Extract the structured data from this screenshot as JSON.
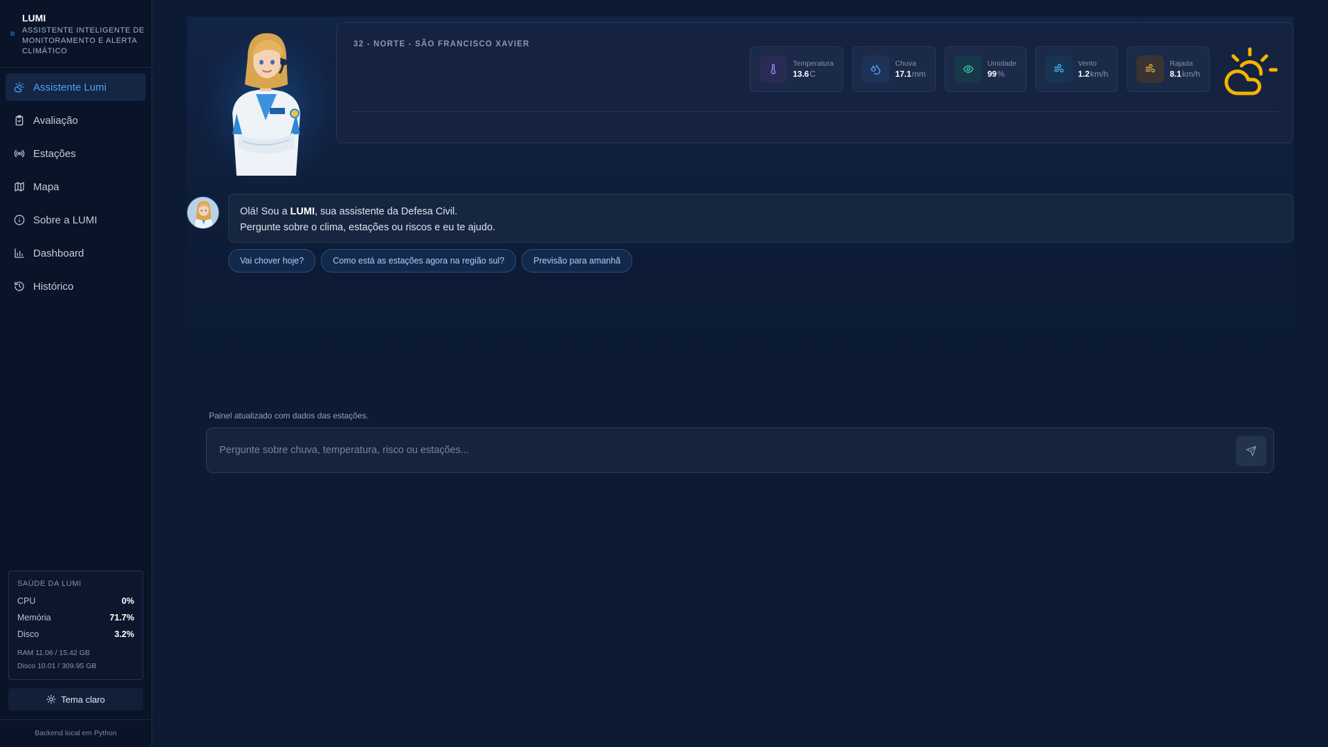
{
  "brand": {
    "title": "LUMI",
    "subtitle": "Assistente inteligente de monitoramento e alerta climático"
  },
  "nav": {
    "items": [
      {
        "label": "Assistente Lumi",
        "icon": "weather-icon",
        "active": true
      },
      {
        "label": "Avaliação",
        "icon": "clipboard-icon"
      },
      {
        "label": "Estações",
        "icon": "radio-icon"
      },
      {
        "label": "Mapa",
        "icon": "map-icon"
      },
      {
        "label": "Sobre a LUMI",
        "icon": "info-icon"
      },
      {
        "label": "Dashboard",
        "icon": "bar-chart-icon"
      },
      {
        "label": "Histórico",
        "icon": "history-icon"
      }
    ]
  },
  "health": {
    "title": "SAÚDE DA LUMI",
    "cpu_label": "CPU",
    "cpu_value": "0%",
    "mem_label": "Memória",
    "mem_value": "71.7%",
    "disk_label": "Disco",
    "disk_value": "3.2%",
    "ram_detail": "RAM 11.06 / 15.42 GB",
    "disk_detail": "Disco 10.01 / 309.95 GB"
  },
  "theme_button": {
    "label": "Tema claro",
    "icon": "sun-icon"
  },
  "footer": {
    "text": "Backend local em Python"
  },
  "weather": {
    "station": "32 - NORTE - SÃO FRANCISCO XAVIER",
    "big_icon": "partly-sunny-icon",
    "accent": "#f5b400",
    "metrics": [
      {
        "label": "Temperatura",
        "value": "13.6",
        "unit": "C",
        "icon": "thermometer-icon",
        "color": "#a98bff",
        "bg": "#2a2b55"
      },
      {
        "label": "Chuva",
        "value": "17.1",
        "unit": "mm",
        "icon": "droplets-icon",
        "color": "#5aa7ff",
        "bg": "#1f3358"
      },
      {
        "label": "Umidade",
        "value": "99",
        "unit": "%",
        "icon": "eye-icon",
        "color": "#3fd3a6",
        "bg": "#17384a"
      },
      {
        "label": "Vento",
        "value": "1.2",
        "unit": "km/h",
        "icon": "wind-icon",
        "color": "#45c4ff",
        "bg": "#173552"
      },
      {
        "label": "Rajada",
        "value": "8.1",
        "unit": "km/h",
        "icon": "wind-gust-icon",
        "color": "#f3b53c",
        "bg": "#3a3333"
      }
    ]
  },
  "chat": {
    "greeting_pre": "Olá! Sou a ",
    "greeting_bold": "LUMI",
    "greeting_post": ", sua assistente da Defesa Civil.",
    "line2": "Pergunte sobre o clima, estações ou riscos e eu te ajudo.",
    "suggestions": [
      "Vai chover hoje?",
      "Como está as estações agora na região sul?",
      "Previsão para amanhã"
    ]
  },
  "status": {
    "text": "Painel atualizado com dados das estações."
  },
  "input": {
    "placeholder": "Pergunte sobre chuva, temperatura, risco ou estações...",
    "value": ""
  },
  "send": {
    "icon": "send-icon"
  }
}
